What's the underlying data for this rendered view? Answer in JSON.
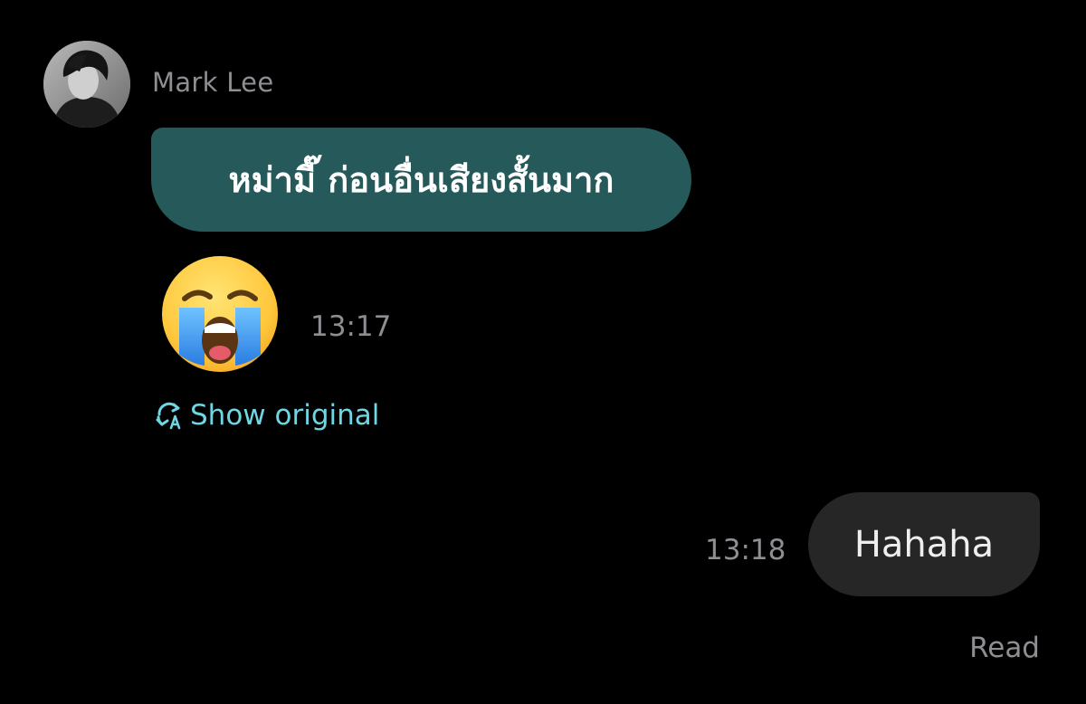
{
  "incoming": {
    "sender_name": "Mark Lee",
    "avatar": "avatar-photo",
    "message_text": "หม่ามี๊ ก่อนอื่นเสียงสั้นมาก",
    "emoji": "loudly-crying-face",
    "time": "13:17",
    "show_original_label": "Show original",
    "translate_icon": "translate-icon"
  },
  "outgoing": {
    "message_text": "Hahaha",
    "time": "13:18",
    "read_status": "Read"
  },
  "colors": {
    "background": "#000000",
    "incoming_bubble": "#25595a",
    "outgoing_bubble": "#262626",
    "muted_text": "#8e8e93",
    "link": "#6fd6e3"
  }
}
